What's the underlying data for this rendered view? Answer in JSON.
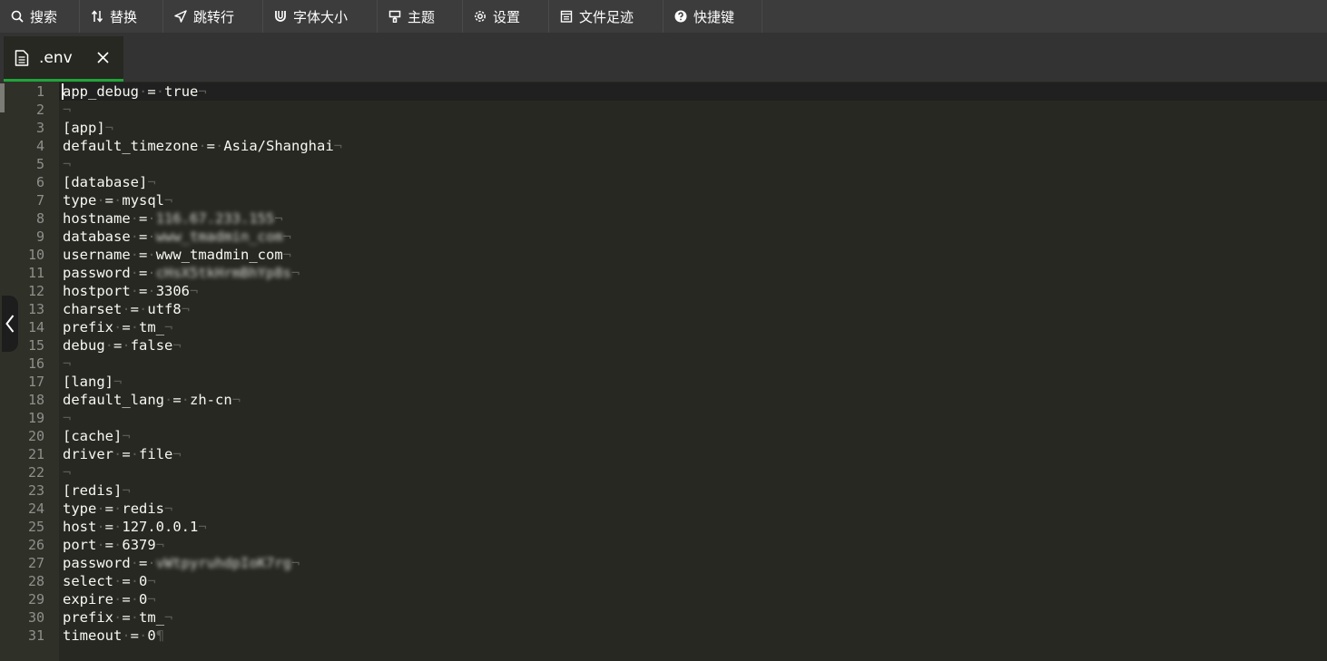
{
  "toolbar": {
    "items": [
      {
        "label": "搜索",
        "icon": "search-icon"
      },
      {
        "label": "替换",
        "icon": "replace-icon"
      },
      {
        "label": "跳转行",
        "icon": "jump-icon"
      },
      {
        "label": "字体大小",
        "icon": "font-size-icon"
      },
      {
        "label": "主题",
        "icon": "theme-icon"
      },
      {
        "label": "设置",
        "icon": "gear-icon"
      },
      {
        "label": "文件足迹",
        "icon": "file-history-icon"
      },
      {
        "label": "快捷键",
        "icon": "help-icon"
      }
    ]
  },
  "tab": {
    "label": ".env",
    "icon": "file-icon",
    "close_icon": "close-icon",
    "accent": "#20a53a"
  },
  "editor": {
    "theme_background": "#272822",
    "line_numbers": [
      "1",
      "2",
      "3",
      "4",
      "5",
      "6",
      "7",
      "8",
      "9",
      "10",
      "11",
      "12",
      "13",
      "14",
      "15",
      "16",
      "17",
      "18",
      "19",
      "20",
      "21",
      "22",
      "23",
      "24",
      "25",
      "26",
      "27",
      "28",
      "29",
      "30",
      "31"
    ],
    "lines": [
      {
        "key": "app_debug",
        "value": "true"
      },
      {
        "text": ""
      },
      {
        "text": "[app]"
      },
      {
        "key": "default_timezone",
        "value": "Asia/Shanghai"
      },
      {
        "text": ""
      },
      {
        "text": "[database]"
      },
      {
        "key": "type",
        "value": "mysql"
      },
      {
        "key": "hostname",
        "value": "116.67.233.155",
        "redacted": true
      },
      {
        "key": "database",
        "value": "www_tmadmin_com",
        "redacted": true
      },
      {
        "key": "username",
        "value": "www_tmadmin_com"
      },
      {
        "key": "password",
        "value": "cHsX5tkHrmBhYp8s",
        "redacted": true
      },
      {
        "key": "hostport",
        "value": "3306"
      },
      {
        "key": "charset",
        "value": "utf8"
      },
      {
        "key": "prefix",
        "value": "tm_"
      },
      {
        "key": "debug",
        "value": "false"
      },
      {
        "text": ""
      },
      {
        "text": "[lang]"
      },
      {
        "key": "default_lang",
        "value": "zh-cn"
      },
      {
        "text": ""
      },
      {
        "text": "[cache]"
      },
      {
        "key": "driver",
        "value": "file"
      },
      {
        "text": ""
      },
      {
        "text": "[redis]"
      },
      {
        "key": "type",
        "value": "redis"
      },
      {
        "key": "host",
        "value": "127.0.0.1"
      },
      {
        "key": "port",
        "value": "6379"
      },
      {
        "key": "password",
        "value": "vWtpyruhdpIoK7rg",
        "redacted": true
      },
      {
        "key": "select",
        "value": "0"
      },
      {
        "key": "expire",
        "value": "0"
      },
      {
        "key": "prefix",
        "value": "tm_"
      },
      {
        "key": "timeout",
        "value": "0",
        "eof": true
      }
    ]
  }
}
